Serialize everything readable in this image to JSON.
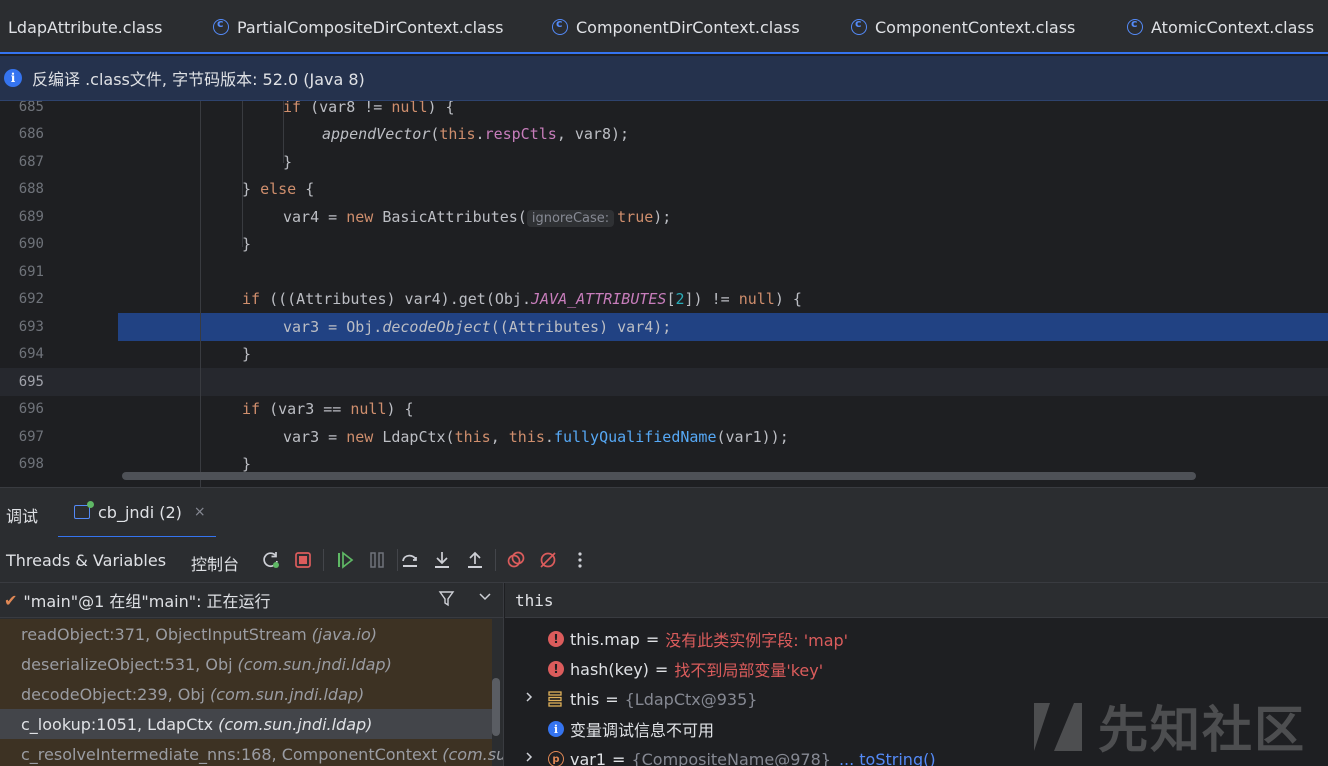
{
  "tabs": [
    {
      "label": "LdapAttribute.class",
      "icon": "class-icon"
    },
    {
      "label": "PartialCompositeDirContext.class",
      "icon": "class-icon"
    },
    {
      "label": "ComponentDirContext.class",
      "icon": "class-icon"
    },
    {
      "label": "ComponentContext.class",
      "icon": "class-icon"
    },
    {
      "label": "AtomicContext.class",
      "icon": "class-icon"
    }
  ],
  "banner": {
    "text": "反编译 .class文件, 字节码版本: 52.0 (Java 8)"
  },
  "editor": {
    "lines": [
      {
        "num": "685",
        "text": "if (var8 != null) {"
      },
      {
        "num": "686",
        "text": "appendVector(this.respCtls, var8);"
      },
      {
        "num": "687",
        "text": "}"
      },
      {
        "num": "688",
        "text": "} else {"
      },
      {
        "num": "689",
        "text": "var4 = new BasicAttributes( ignoreCase: true);",
        "hint": "ignoreCase:"
      },
      {
        "num": "690",
        "text": "}"
      },
      {
        "num": "691",
        "text": ""
      },
      {
        "num": "692",
        "text": "if (((Attributes) var4).get(Obj.JAVA_ATTRIBUTES[2]) != null) {"
      },
      {
        "num": "693",
        "text": "var3 = Obj.decodeObject((Attributes) var4);"
      },
      {
        "num": "694",
        "text": "}"
      },
      {
        "num": "695",
        "text": ""
      },
      {
        "num": "696",
        "text": "if (var3 == null) {"
      },
      {
        "num": "697",
        "text": "var3 = new LdapCtx(this, this.fullyQualifiedName(var1));"
      },
      {
        "num": "698",
        "text": "}"
      }
    ]
  },
  "debug": {
    "title": "调试",
    "session_label": "cb_jndi (2)",
    "close_glyph": "×",
    "toolbar": {
      "threads_tab": "Threads & Variables",
      "console_tab": "控制台"
    },
    "thread": {
      "label": "\"main\"@1 在组\"main\": 正在运行"
    },
    "frames": [
      {
        "method": "readObject:371, ObjectInputStream",
        "pkg": "(java.io)"
      },
      {
        "method": "deserializeObject:531, Obj",
        "pkg": "(com.sun.jndi.ldap)"
      },
      {
        "method": "decodeObject:239, Obj",
        "pkg": "(com.sun.jndi.ldap)"
      },
      {
        "method": "c_lookup:1051, LdapCtx",
        "pkg": "(com.sun.jndi.ldap)"
      },
      {
        "method": "c_resolveIntermediate_nns:168, ComponentContext",
        "pkg": "(com.sun.j"
      }
    ],
    "eval_expression": "this",
    "variables": [
      {
        "name": "this.map",
        "eq": "=",
        "value": "没有此类实例字段: 'map'",
        "kind": "error"
      },
      {
        "name": "hash(key)",
        "eq": "=",
        "value": "找不到局部变量'key'",
        "kind": "error"
      },
      {
        "name": "this",
        "eq": "=",
        "value": "{LdapCtx@935}",
        "kind": "object"
      },
      {
        "name": "变量调试信息不可用",
        "kind": "info"
      },
      {
        "name": "var1",
        "eq": "=",
        "value": "{CompositeName@978}",
        "link": "... toString()",
        "kind": "param"
      }
    ]
  },
  "watermark": {
    "text": "先知社区"
  },
  "colors": {
    "accent": "#3574f0",
    "highlight_line": "#214283",
    "keyword": "#cf8e6d",
    "field": "#c77dbb",
    "error": "#db5c5c"
  }
}
